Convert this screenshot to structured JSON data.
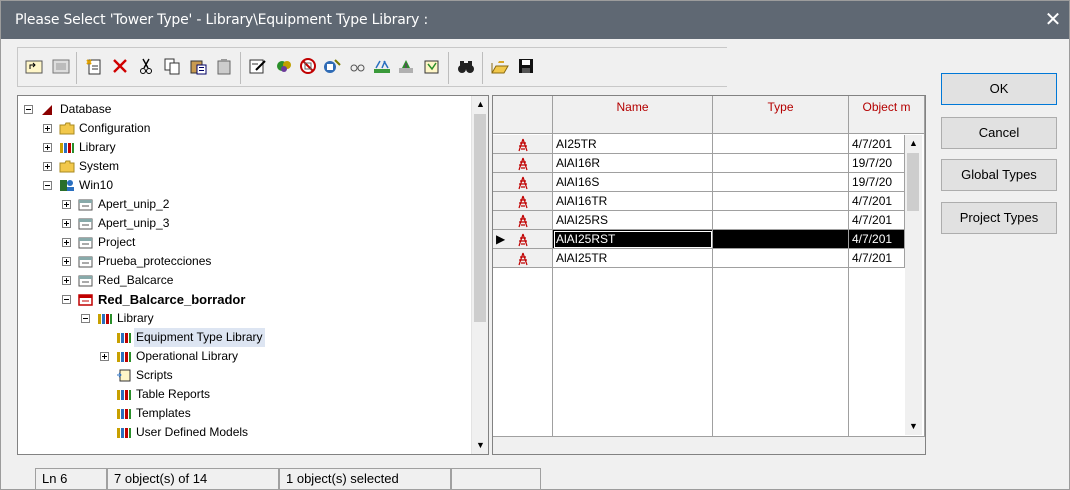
{
  "window": {
    "title": "Please Select 'Tower Type' - Library\\Equipment Type Library :",
    "close_glyph": "✕"
  },
  "toolbar": {
    "buttons": [
      "up-level-icon",
      "detail-mode-icon",
      "new-object-icon",
      "delete-icon",
      "cut-icon",
      "copy-icon",
      "paste-icon",
      "paste-special-icon",
      "edit-object-icon",
      "mark-icon",
      "show-not-used-icon",
      "filter-icon",
      "find-icon",
      "variation-icon",
      "project-icon",
      "template-icon",
      "binoculars-icon",
      "open-folder-icon",
      "save-icon"
    ]
  },
  "tree": {
    "items": [
      {
        "label": "Database",
        "icon": "database-icon",
        "expander": "minus",
        "level": 0
      },
      {
        "label": "Configuration",
        "icon": "folder-icon",
        "expander": "plus",
        "level": 1
      },
      {
        "label": "Library",
        "icon": "library-icon",
        "expander": "plus",
        "level": 1
      },
      {
        "label": "System",
        "icon": "folder-icon",
        "expander": "plus",
        "level": 1
      },
      {
        "label": "Win10",
        "icon": "user-icon",
        "expander": "minus",
        "level": 1
      },
      {
        "label": "Apert_unip_2",
        "icon": "project-icon",
        "expander": "plus",
        "level": 2
      },
      {
        "label": "Apert_unip_3",
        "icon": "project-icon",
        "expander": "plus",
        "level": 2
      },
      {
        "label": "Project",
        "icon": "project-icon",
        "expander": "plus",
        "level": 2
      },
      {
        "label": "Prueba_protecciones",
        "icon": "project-icon",
        "expander": "plus",
        "level": 2
      },
      {
        "label": "Red_Balcarce",
        "icon": "project-icon",
        "expander": "plus",
        "level": 2
      },
      {
        "label": "Red_Balcarce_borrador",
        "icon": "active-project-icon",
        "expander": "minus",
        "level": 2,
        "bold": true
      },
      {
        "label": "Library",
        "icon": "library-icon",
        "expander": "minus",
        "level": 3
      },
      {
        "label": "Equipment Type Library",
        "icon": "library-icon",
        "expander": "none",
        "level": 4,
        "selected": true
      },
      {
        "label": "Operational Library",
        "icon": "library-icon",
        "expander": "plus",
        "level": 4
      },
      {
        "label": "Scripts",
        "icon": "script-icon",
        "expander": "none",
        "level": 4
      },
      {
        "label": "Table Reports",
        "icon": "library-icon",
        "expander": "none",
        "level": 4
      },
      {
        "label": "Templates",
        "icon": "library-icon",
        "expander": "none",
        "level": 4
      },
      {
        "label": "User Defined Models",
        "icon": "library-icon",
        "expander": "none",
        "level": 4
      }
    ]
  },
  "grid": {
    "columns": [
      "Name",
      "Type",
      "Object m"
    ],
    "rows": [
      {
        "name": "AI25TR",
        "type": "",
        "date": "4/7/201"
      },
      {
        "name": "AlAI16R",
        "type": "",
        "date": "19/7/20"
      },
      {
        "name": "AlAI16S",
        "type": "",
        "date": "19/7/20"
      },
      {
        "name": "AlAI16TR",
        "type": "",
        "date": "4/7/201"
      },
      {
        "name": "AlAI25RS",
        "type": "",
        "date": "4/7/201"
      },
      {
        "name": "AlAI25RST",
        "type": "",
        "date": "4/7/201",
        "selected": true
      },
      {
        "name": "AlAI25TR",
        "type": "",
        "date": "4/7/201"
      }
    ],
    "row_icon": "tower-icon",
    "current_row_marker": "▶"
  },
  "buttons": {
    "ok": "OK",
    "cancel": "Cancel",
    "global_types": "Global Types",
    "project_types": "Project Types"
  },
  "status": {
    "line": "Ln 6",
    "objects": "7 object(s) of 14",
    "selected": "1 object(s) selected",
    "extra": ""
  },
  "colors": {
    "titlebar": "#5f6873",
    "header_text": "#b40000",
    "selection": "#000000"
  }
}
